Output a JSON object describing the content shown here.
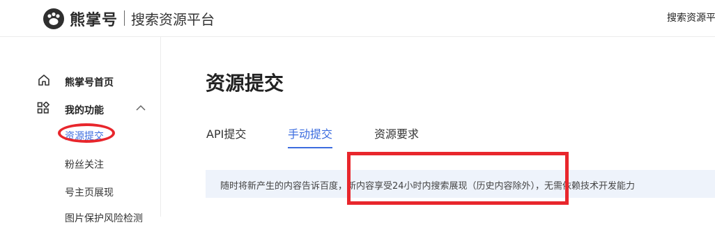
{
  "header": {
    "brand": "熊掌号",
    "subtitle": "搜索资源平台",
    "right_link": "搜索资源平"
  },
  "sidebar": {
    "home": "熊掌号首页",
    "functions": "我的功能",
    "items": [
      "资源提交",
      "粉丝关注",
      "号主页展现",
      "图片保护风险检测"
    ]
  },
  "main": {
    "title": "资源提交",
    "tabs": [
      {
        "label": "API提交",
        "active": false
      },
      {
        "label": "手动提交",
        "active": true
      },
      {
        "label": "资源要求",
        "active": false
      }
    ],
    "info_text": "随时将新产生的内容告诉百度，新内容享受24小时内搜索展现（历史内容除外），无需依赖技术开发能力"
  },
  "colors": {
    "accent": "#3b6cdf",
    "annotation_red": "#e8262c",
    "info_bg": "#eef3fb"
  },
  "icons": [
    "paw-logo-icon",
    "home-icon",
    "grid-apps-icon",
    "chevron-up-icon"
  ]
}
